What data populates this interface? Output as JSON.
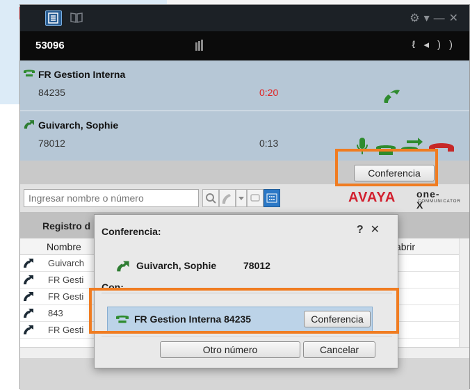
{
  "titlebar": {
    "icons": [
      "contacts-tab-icon",
      "book-tab-icon",
      "settings-icon",
      "minimize-icon",
      "close-icon"
    ]
  },
  "extension": {
    "number": "53096"
  },
  "calls": [
    {
      "name": "FR Gestion Interna",
      "number": "84235",
      "time": "0:20",
      "status": "hold"
    },
    {
      "name": "Guivarch, Sophie",
      "number": "78012",
      "time": "0:13",
      "status": "active"
    }
  ],
  "conf_strip": {
    "button_label": "Conferencia"
  },
  "search": {
    "placeholder": "Ingresar nombre o número"
  },
  "brand": {
    "avaya": "AVAYA",
    "onex": "one-X",
    "sub": "COMMUNICATOR"
  },
  "history": {
    "title": "Registro d",
    "columns": [
      "Nombre",
      "abrir"
    ],
    "rows": [
      "Guivarch",
      "FR Gesti",
      "FR Gesti",
      "843",
      "FR Gesti"
    ]
  },
  "dialog": {
    "title": "Conferencia:",
    "help": "?",
    "close": "✕",
    "call_name": "Guivarch, Sophie",
    "call_number": "78012",
    "with_label": "Con:",
    "target_name": "FR Gestion Interna",
    "target_number": "84235",
    "conf_button": "Conferencia",
    "other_button": "Otro número",
    "cancel_button": "Cancelar"
  },
  "colors": {
    "highlight": "#f07c21",
    "accent_green": "#2e7d32",
    "hangup_red": "#c62828"
  }
}
